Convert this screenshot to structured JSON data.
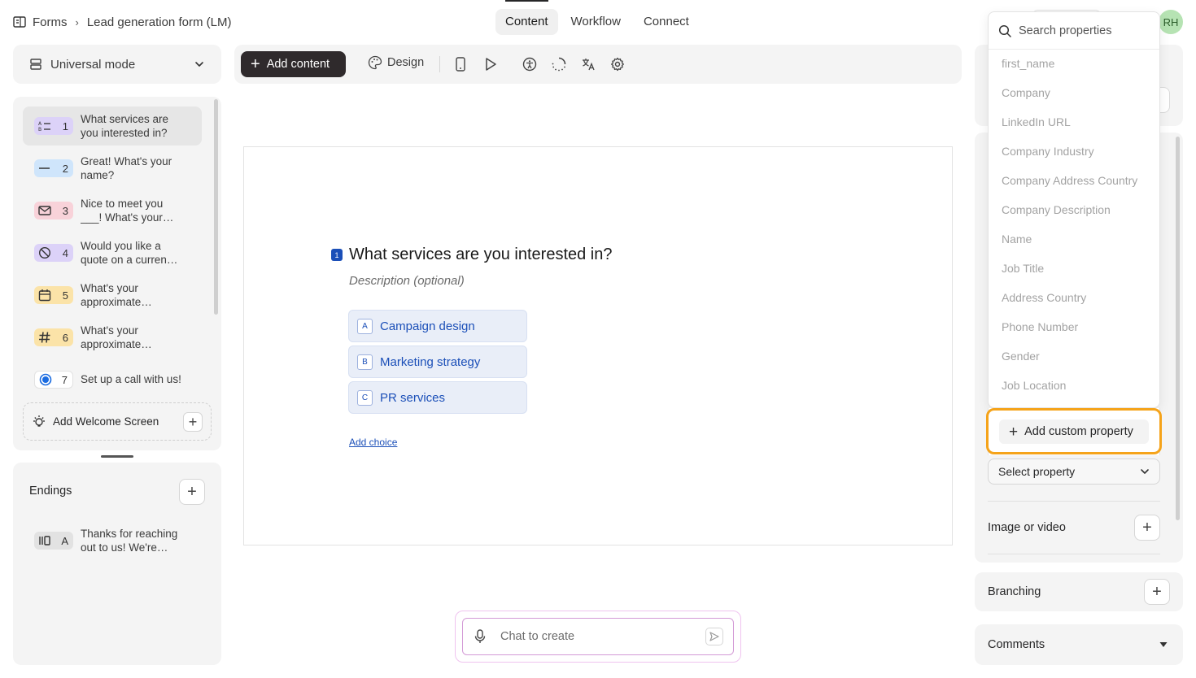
{
  "breadcrumb": {
    "root": "Forms",
    "current": "Lead generation form (LM)"
  },
  "tabs": [
    {
      "label": "Content",
      "active": true
    },
    {
      "label": "Workflow",
      "active": false
    },
    {
      "label": "Connect",
      "active": false
    }
  ],
  "user": {
    "initials": "RH"
  },
  "mode": {
    "label": "Universal mode"
  },
  "questions": [
    {
      "num": "1",
      "text": "What services are you interested in?",
      "icon": "multiple-choice-icon",
      "color": "#dcd2f8",
      "selected": true
    },
    {
      "num": "2",
      "text": "Great! What's your name?",
      "icon": "short-text-icon",
      "color": "#cfe5fb"
    },
    {
      "num": "3",
      "text": "Nice to meet you ___! What's your…",
      "icon": "email-icon",
      "color": "#f8d2d9"
    },
    {
      "num": "4",
      "text": "Would you like a quote on a curren…",
      "icon": "no-icon",
      "color": "#dcd2f8"
    },
    {
      "num": "5",
      "text": "What's your approximate…",
      "icon": "calendar-icon",
      "color": "#fbe3a8"
    },
    {
      "num": "6",
      "text": "What's your approximate…",
      "icon": "number-icon",
      "color": "#fbe3a8"
    },
    {
      "num": "7",
      "text": "Set up a call with us!",
      "icon": "calendly-icon",
      "color": "#ffffff"
    }
  ],
  "welcome": {
    "label": "Add Welcome Screen"
  },
  "endings": {
    "title": "Endings",
    "items": [
      {
        "key": "A",
        "text": "Thanks for reaching out to us! We're…"
      }
    ]
  },
  "toolbar": {
    "add_content": "Add content",
    "design": "Design"
  },
  "question": {
    "number": "1",
    "title": "What services are you interested in?",
    "description": "Description (optional)",
    "choices": [
      {
        "key": "A",
        "label": "Campaign design"
      },
      {
        "key": "B",
        "label": "Marketing strategy"
      },
      {
        "key": "C",
        "label": "PR services"
      }
    ],
    "add_choice": "Add choice"
  },
  "chat": {
    "placeholder": "Chat to create"
  },
  "properties_dropdown": {
    "search_placeholder": "Search properties",
    "items": [
      "first_name",
      "Company",
      "LinkedIn URL",
      "Company Industry",
      "Company Address Country",
      "Company Description",
      "Name",
      "Job Title",
      "Address Country",
      "Phone Number",
      "Gender",
      "Job Location"
    ],
    "add_custom": "Add custom property"
  },
  "right_panel": {
    "select_property": "Select property",
    "image_or_video": "Image or video",
    "branching": "Branching",
    "comments": "Comments"
  },
  "colors": {
    "accent": "#1b4fb8",
    "highlight": "#f5a31a",
    "dark_button": "#2f2a2c",
    "avatar": "#b6e3b3"
  }
}
